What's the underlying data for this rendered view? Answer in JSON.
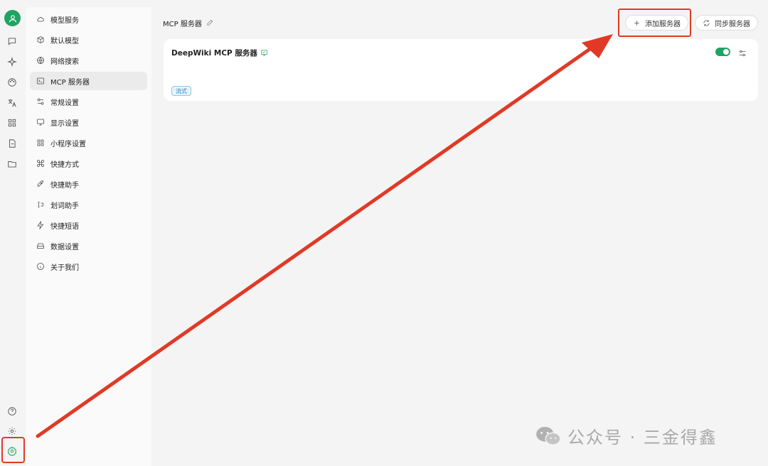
{
  "sidebar": {
    "items": [
      {
        "label": "模型服务",
        "icon": "cloud-icon"
      },
      {
        "label": "默认模型",
        "icon": "cube-icon"
      },
      {
        "label": "网络搜索",
        "icon": "globe-icon"
      },
      {
        "label": "MCP 服务器",
        "icon": "terminal-icon"
      },
      {
        "label": "常规设置",
        "icon": "sliders-icon"
      },
      {
        "label": "显示设置",
        "icon": "monitor-icon"
      },
      {
        "label": "小程序设置",
        "icon": "grid-icon"
      },
      {
        "label": "快捷方式",
        "icon": "command-icon"
      },
      {
        "label": "快捷助手",
        "icon": "rocket-icon"
      },
      {
        "label": "划词助手",
        "icon": "text-select-icon"
      },
      {
        "label": "快捷短语",
        "icon": "zap-icon"
      },
      {
        "label": "数据设置",
        "icon": "hard-drive-icon"
      },
      {
        "label": "关于我们",
        "icon": "info-icon"
      }
    ],
    "active_index": 3
  },
  "header": {
    "title": "MCP 服务器",
    "add_button": "添加服务器",
    "sync_button": "同步服务器"
  },
  "server_card": {
    "name": "DeepWiki MCP 服务器",
    "enabled": true,
    "tag": "流式"
  },
  "watermark": {
    "text": "公众号 · 三金得鑫"
  },
  "colors": {
    "accent": "#1fa463",
    "annotation": "#e03a26",
    "tag_text": "#2a86c6"
  }
}
